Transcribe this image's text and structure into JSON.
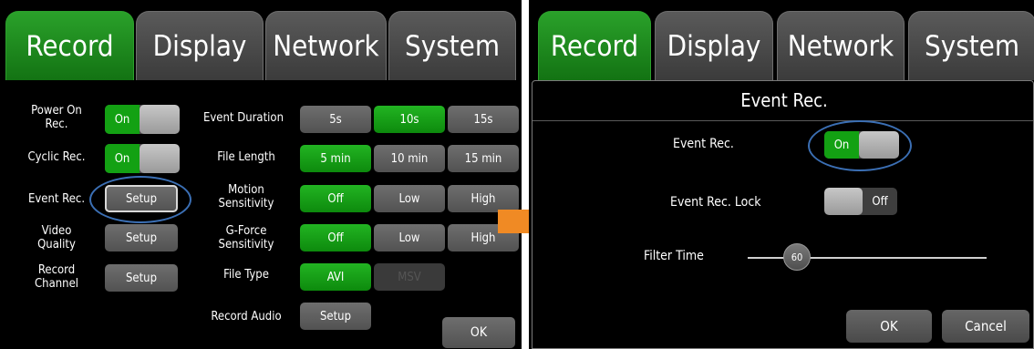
{
  "left": {
    "tabs": [
      {
        "label": "Record",
        "active": true
      },
      {
        "label": "Display",
        "active": false
      },
      {
        "label": "Network",
        "active": false
      },
      {
        "label": "System",
        "active": false
      }
    ],
    "power_on_rec": {
      "label": "Power On Rec.",
      "value": "On"
    },
    "cyclic_rec": {
      "label": "Cyclic Rec.",
      "value": "On"
    },
    "event_rec": {
      "label": "Event Rec.",
      "button": "Setup"
    },
    "video_quality": {
      "label": "Video Quality",
      "button": "Setup"
    },
    "record_channel": {
      "label": "Record Channel",
      "button": "Setup"
    },
    "event_duration": {
      "label": "Event Duration",
      "options": [
        "5s",
        "10s",
        "15s"
      ],
      "selected": "10s"
    },
    "file_length": {
      "label": "File Length",
      "options": [
        "5 min",
        "10 min",
        "15 min"
      ],
      "selected": "5 min"
    },
    "motion_sensitivity": {
      "label": "Motion Sensitivity",
      "options": [
        "Off",
        "Low",
        "High"
      ],
      "selected": "Off"
    },
    "gforce_sensitivity": {
      "label": "G-Force Sensitivity",
      "options": [
        "Off",
        "Low",
        "High"
      ],
      "selected": "Off"
    },
    "file_type": {
      "label": "File Type",
      "options": [
        "AVI",
        "MSV"
      ],
      "selected": "AVI"
    },
    "record_audio": {
      "label": "Record Audio",
      "button": "Setup"
    },
    "ok": "OK"
  },
  "right": {
    "tabs": [
      {
        "label": "Record",
        "active": true
      },
      {
        "label": "Display",
        "active": false
      },
      {
        "label": "Network",
        "active": false
      },
      {
        "label": "System",
        "active": false
      }
    ],
    "dialog_title": "Event Rec.",
    "event_rec": {
      "label": "Event Rec.",
      "value": "On"
    },
    "event_rec_lock": {
      "label": "Event Rec. Lock",
      "value": "Off"
    },
    "filter_time": {
      "label": "Filter Time",
      "value": "60",
      "fraction": 0.2
    },
    "ok": "OK",
    "cancel": "Cancel"
  },
  "colors": {
    "active_green": "#1b9a1b",
    "highlight_ring": "#3b6fb4",
    "arrow": "#f08a24"
  }
}
